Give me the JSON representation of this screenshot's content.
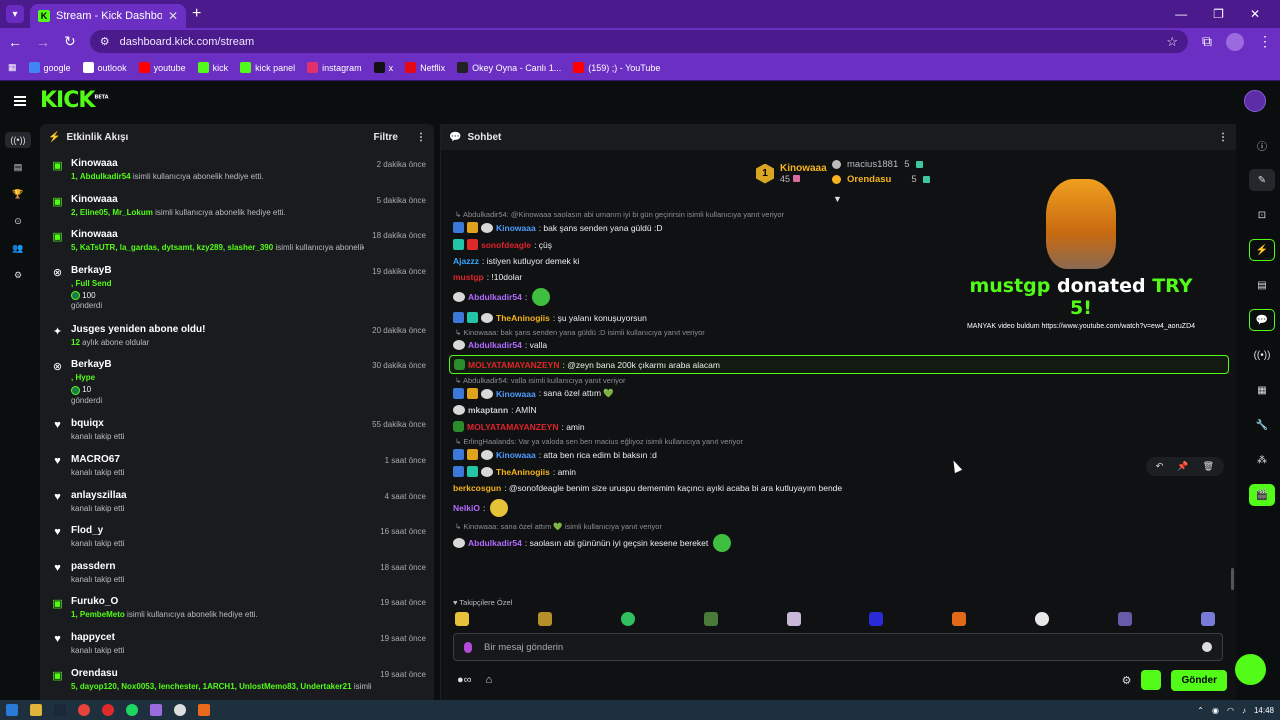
{
  "browser": {
    "tab_title": "Stream - Kick Dashboard",
    "tab_favicon_letter": "K",
    "new_tab": "+",
    "url": "dashboard.kick.com/stream",
    "bookmarks": [
      {
        "label": "google",
        "color": "#4285f4"
      },
      {
        "label": "outlook",
        "color": "#ffffff"
      },
      {
        "label": "youtube",
        "color": "#ff0000"
      },
      {
        "label": "kick",
        "color": "#53fc18"
      },
      {
        "label": "kick panel",
        "color": "#53fc18"
      },
      {
        "label": "instagram",
        "color": "#e1306c"
      },
      {
        "label": "x",
        "color": "#111111"
      },
      {
        "label": "Netflix",
        "color": "#e50914"
      },
      {
        "label": "Okey Oyna - Canlı 1...",
        "color": "#222222"
      },
      {
        "label": "(159) ;) - YouTube",
        "color": "#ff0000"
      }
    ]
  },
  "header": {
    "logo": "KICK",
    "logo_sup": "BETA"
  },
  "activity": {
    "title": "Etkinlik Akışı",
    "filter": "Filtre",
    "items": [
      {
        "icon": "gift",
        "name": "Kinowaaa",
        "time": "2 dakika önce",
        "count": "1,",
        "users": "Abdulkadir54",
        "text": "isimli kullanıcıya abonelik hediye etti."
      },
      {
        "icon": "gift",
        "name": "Kinowaaa",
        "time": "5 dakika önce",
        "count": "2,",
        "users": "Eline05, Mr_Lokum",
        "text": "isimli kullanıcıya abonelik hediye etti."
      },
      {
        "icon": "gift",
        "name": "Kinowaaa",
        "time": "18 dakika önce",
        "count": "5,",
        "users": "KaTsUTR, la_gardas, dytsamt, kzy289, slasher_390",
        "text": "isimli kullanıcıya abonelik hediye etti."
      },
      {
        "icon": "kick",
        "name": "BerkayB",
        "time": "19 dakika önce",
        "count": ",",
        "users": "Full Send",
        "kicks": "100",
        "kicks_label": "gönderdi"
      },
      {
        "icon": "sparkle",
        "name": "Jusges yeniden abone oldu!",
        "time": "20 dakika önce",
        "count": "12",
        "text": "aylık abone oldular"
      },
      {
        "icon": "kick",
        "name": "BerkayB",
        "time": "30 dakika önce",
        "count": ",",
        "users": "Hype",
        "kicks": "10",
        "kicks_label": "gönderdi"
      },
      {
        "icon": "heart",
        "name": "bquiqx",
        "time": "55 dakika önce",
        "text": "kanalı takip etti"
      },
      {
        "icon": "heart",
        "name": "MACRO67",
        "time": "1 saat önce",
        "text": "kanalı takip etti"
      },
      {
        "icon": "heart",
        "name": "anlayszillaa",
        "time": "4 saat önce",
        "text": "kanalı takip etti"
      },
      {
        "icon": "heart",
        "name": "Flod_y",
        "time": "16 saat önce",
        "text": "kanalı takip etti"
      },
      {
        "icon": "heart",
        "name": "passdern",
        "time": "18 saat önce",
        "text": "kanalı takip etti"
      },
      {
        "icon": "gift",
        "name": "Furuko_O",
        "time": "19 saat önce",
        "count": "1,",
        "users": "PembeMeto",
        "text": "isimli kullanıcıya abonelik hediye etti."
      },
      {
        "icon": "heart",
        "name": "happycet",
        "time": "19 saat önce",
        "text": "kanalı takip etti"
      },
      {
        "icon": "gift",
        "name": "Orendasu",
        "time": "19 saat önce",
        "count": "5,",
        "users": "dayop120, Nox0053, lenchester, 1ARCH1, UnlostMemo83, Undertaker21",
        "text": "isimli kullanıcıya"
      }
    ]
  },
  "chat": {
    "title": "Sohbet",
    "leaderboard": {
      "first": {
        "rank": "1",
        "name": "Kinowaaa",
        "count": "45"
      },
      "others": [
        {
          "name": "macius1881",
          "count": "5",
          "color": "#bbbbbb"
        },
        {
          "name": "Orendasu",
          "count": "5",
          "color": "#f5b31e"
        }
      ]
    },
    "messages": [
      {
        "reply": "Abdulkadir54: @Kinowaaa saolasın abi umarım iyi bi gün geçirirsin isimli kullanıcıya yanıt veriyor",
        "badges": [
          "blue",
          "gold",
          "cat"
        ],
        "user": "Kinowaaa",
        "color": "#4f9cff",
        "text": ": bak şans senden yana güldü :D"
      },
      {
        "badges": [
          "teal",
          "red"
        ],
        "user": "sonofdeagle",
        "color": "#e0242c",
        "text": ": çüş"
      },
      {
        "badges": [],
        "user": "Ajazzz",
        "color": "#3aa6ff",
        "text": ": istiyen kutluyor demek ki"
      },
      {
        "badges": [],
        "user": "mustgp",
        "color": "#e0242c",
        "text": ": !10dolar"
      },
      {
        "badges": [
          "cat"
        ],
        "user": "Abdulkadir54",
        "color": "#b36cff",
        "text": ":",
        "emote": "g"
      },
      {
        "badges": [
          "blue",
          "teal",
          "cat"
        ],
        "user": "TheAninogiis",
        "color": "#f5b31e",
        "text": ": şu yalanı konuşuyorsun"
      },
      {
        "reply": "Kinowaaa: bak şans senden yana güldü :D isimli kullanıcıya yanıt veriyor",
        "badges": [
          "cat"
        ],
        "user": "Abdulkadir54",
        "color": "#b36cff",
        "text": ": valla"
      },
      {
        "badges": [
          "frog"
        ],
        "user": "MOLYATAMAYANZEYN",
        "color": "#e0242c",
        "text": ": @zeyn bana 200k çıkarmı araba alacam",
        "highlight": true
      },
      {
        "reply": "Abdulkadir54: valla isimli kullanıcıya yanıt veriyor",
        "badges": [
          "blue",
          "gold",
          "cat"
        ],
        "user": "Kinowaaa",
        "color": "#4f9cff",
        "text": ": sana özel attım 💚"
      },
      {
        "badges": [
          "cat"
        ],
        "user": "mkaptann",
        "color": "#cfcfcf",
        "text": ": AMİN"
      },
      {
        "badges": [
          "frog"
        ],
        "user": "MOLYATAMAYANZEYN",
        "color": "#e0242c",
        "text": ": amin"
      },
      {
        "reply": "ErlingHaalands: Var ya valoda sen ben macius eğliyoz isimli kullanıcıya yanıt veriyor",
        "badges": [
          "blue",
          "gold",
          "cat"
        ],
        "user": "Kinowaaa",
        "color": "#4f9cff",
        "text": ": atta ben rica edim bi baksın :d"
      },
      {
        "badges": [
          "blue",
          "teal",
          "cat"
        ],
        "user": "TheAninogiis",
        "color": "#f5b31e",
        "text": ": amin"
      },
      {
        "badges": [],
        "user": "berkcosgun",
        "color": "#f5b31e",
        "text": ": @sonofdeagle benim size uruspu dememim kaçıncı ayıki acaba bi ara kutluyayım bende"
      },
      {
        "badges": [],
        "user": "NelkiO",
        "color": "#b36cff",
        "text": ":",
        "emote": "y"
      },
      {
        "reply": "Kinowaaa: sana özel attım 💚 isimli kullanıcıya yanıt veriyor",
        "badges": [
          "cat"
        ],
        "user": "Abdulkadir54",
        "color": "#b36cff",
        "text": ": saolasın abi gününün iyi geçsin kesene bereket",
        "emote": "g"
      }
    ],
    "donation": {
      "user": "mustgp",
      "word": "donated",
      "amount": "TRY 5!",
      "message": "MANYAK video buldum https://www.youtube.com/watch?v=ew4_aoruZD4"
    },
    "followers_label": "Takipçilere Özel",
    "input_placeholder": "Bir mesaj gönderin",
    "send": "Gönder"
  },
  "taskbar": {
    "time": "14:48"
  }
}
